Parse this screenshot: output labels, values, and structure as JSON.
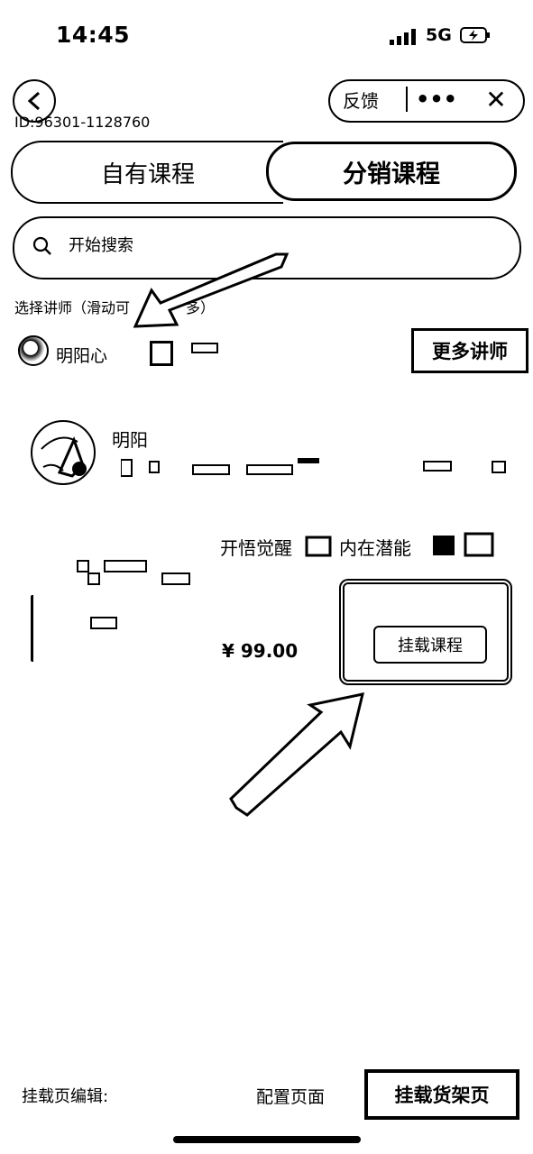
{
  "status_bar": {
    "time": "14:45",
    "network": "5G"
  },
  "nav": {
    "back_icon": "chevron-left-icon",
    "feedback": "反馈",
    "more": "•••",
    "close": "✕",
    "page_id": "ID:96301-1128760"
  },
  "tabs": [
    {
      "label": "自有课程",
      "active": false
    },
    {
      "label": "分销课程",
      "active": true
    }
  ],
  "search": {
    "placeholder": "开始搜索"
  },
  "teacher_selector": {
    "label": "选择讲师（滑动可",
    "label_tail": "多）",
    "teachers": [
      {
        "name": "明阳心"
      }
    ],
    "more_button": "更多讲师"
  },
  "course": {
    "author": "明阳",
    "title": "开悟觉醒",
    "title_part2": "内在潜能",
    "price": "¥ 99.00",
    "mount_button": "挂载课程"
  },
  "bottom_bar": {
    "edit_label": "挂载页编辑:",
    "config_label": "配置页面",
    "mount_shelf_button": "挂载货架页"
  },
  "colors": {
    "foreground": "#000000",
    "background": "#ffffff"
  }
}
